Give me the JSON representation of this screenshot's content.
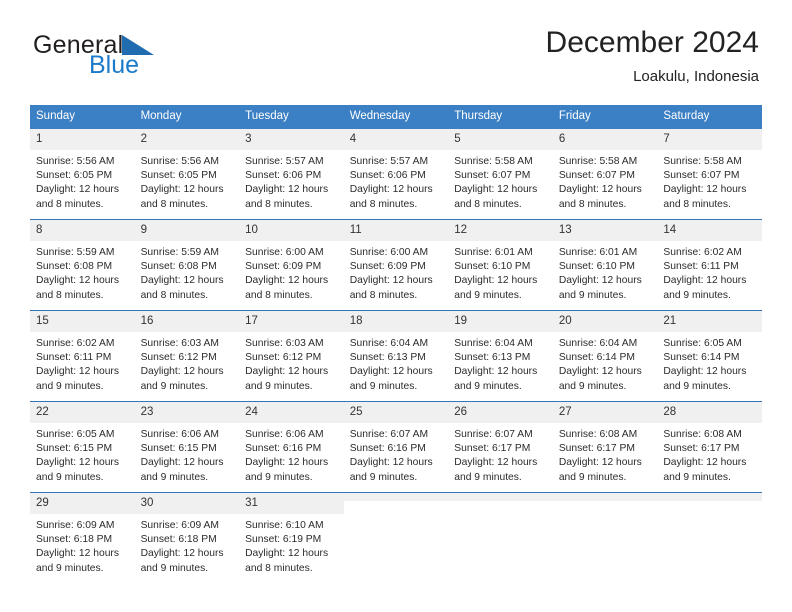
{
  "brand": {
    "name_part1": "General",
    "name_part2": "Blue",
    "logo_icon": "triangle-icon"
  },
  "header": {
    "title": "December 2024",
    "location": "Loakulu, Indonesia"
  },
  "colors": {
    "header_blue": "#3b7fc4",
    "separator_blue": "#2f76bb",
    "daynum_gray": "#f0f0f0",
    "brand_blue": "#1b7ac9"
  },
  "weekday_headers": [
    "Sunday",
    "Monday",
    "Tuesday",
    "Wednesday",
    "Thursday",
    "Friday",
    "Saturday"
  ],
  "weeks": [
    [
      {
        "day": "1",
        "sunrise": "Sunrise: 5:56 AM",
        "sunset": "Sunset: 6:05 PM",
        "daylight1": "Daylight: 12 hours",
        "daylight2": "and 8 minutes."
      },
      {
        "day": "2",
        "sunrise": "Sunrise: 5:56 AM",
        "sunset": "Sunset: 6:05 PM",
        "daylight1": "Daylight: 12 hours",
        "daylight2": "and 8 minutes."
      },
      {
        "day": "3",
        "sunrise": "Sunrise: 5:57 AM",
        "sunset": "Sunset: 6:06 PM",
        "daylight1": "Daylight: 12 hours",
        "daylight2": "and 8 minutes."
      },
      {
        "day": "4",
        "sunrise": "Sunrise: 5:57 AM",
        "sunset": "Sunset: 6:06 PM",
        "daylight1": "Daylight: 12 hours",
        "daylight2": "and 8 minutes."
      },
      {
        "day": "5",
        "sunrise": "Sunrise: 5:58 AM",
        "sunset": "Sunset: 6:07 PM",
        "daylight1": "Daylight: 12 hours",
        "daylight2": "and 8 minutes."
      },
      {
        "day": "6",
        "sunrise": "Sunrise: 5:58 AM",
        "sunset": "Sunset: 6:07 PM",
        "daylight1": "Daylight: 12 hours",
        "daylight2": "and 8 minutes."
      },
      {
        "day": "7",
        "sunrise": "Sunrise: 5:58 AM",
        "sunset": "Sunset: 6:07 PM",
        "daylight1": "Daylight: 12 hours",
        "daylight2": "and 8 minutes."
      }
    ],
    [
      {
        "day": "8",
        "sunrise": "Sunrise: 5:59 AM",
        "sunset": "Sunset: 6:08 PM",
        "daylight1": "Daylight: 12 hours",
        "daylight2": "and 8 minutes."
      },
      {
        "day": "9",
        "sunrise": "Sunrise: 5:59 AM",
        "sunset": "Sunset: 6:08 PM",
        "daylight1": "Daylight: 12 hours",
        "daylight2": "and 8 minutes."
      },
      {
        "day": "10",
        "sunrise": "Sunrise: 6:00 AM",
        "sunset": "Sunset: 6:09 PM",
        "daylight1": "Daylight: 12 hours",
        "daylight2": "and 8 minutes."
      },
      {
        "day": "11",
        "sunrise": "Sunrise: 6:00 AM",
        "sunset": "Sunset: 6:09 PM",
        "daylight1": "Daylight: 12 hours",
        "daylight2": "and 8 minutes."
      },
      {
        "day": "12",
        "sunrise": "Sunrise: 6:01 AM",
        "sunset": "Sunset: 6:10 PM",
        "daylight1": "Daylight: 12 hours",
        "daylight2": "and 9 minutes."
      },
      {
        "day": "13",
        "sunrise": "Sunrise: 6:01 AM",
        "sunset": "Sunset: 6:10 PM",
        "daylight1": "Daylight: 12 hours",
        "daylight2": "and 9 minutes."
      },
      {
        "day": "14",
        "sunrise": "Sunrise: 6:02 AM",
        "sunset": "Sunset: 6:11 PM",
        "daylight1": "Daylight: 12 hours",
        "daylight2": "and 9 minutes."
      }
    ],
    [
      {
        "day": "15",
        "sunrise": "Sunrise: 6:02 AM",
        "sunset": "Sunset: 6:11 PM",
        "daylight1": "Daylight: 12 hours",
        "daylight2": "and 9 minutes."
      },
      {
        "day": "16",
        "sunrise": "Sunrise: 6:03 AM",
        "sunset": "Sunset: 6:12 PM",
        "daylight1": "Daylight: 12 hours",
        "daylight2": "and 9 minutes."
      },
      {
        "day": "17",
        "sunrise": "Sunrise: 6:03 AM",
        "sunset": "Sunset: 6:12 PM",
        "daylight1": "Daylight: 12 hours",
        "daylight2": "and 9 minutes."
      },
      {
        "day": "18",
        "sunrise": "Sunrise: 6:04 AM",
        "sunset": "Sunset: 6:13 PM",
        "daylight1": "Daylight: 12 hours",
        "daylight2": "and 9 minutes."
      },
      {
        "day": "19",
        "sunrise": "Sunrise: 6:04 AM",
        "sunset": "Sunset: 6:13 PM",
        "daylight1": "Daylight: 12 hours",
        "daylight2": "and 9 minutes."
      },
      {
        "day": "20",
        "sunrise": "Sunrise: 6:04 AM",
        "sunset": "Sunset: 6:14 PM",
        "daylight1": "Daylight: 12 hours",
        "daylight2": "and 9 minutes."
      },
      {
        "day": "21",
        "sunrise": "Sunrise: 6:05 AM",
        "sunset": "Sunset: 6:14 PM",
        "daylight1": "Daylight: 12 hours",
        "daylight2": "and 9 minutes."
      }
    ],
    [
      {
        "day": "22",
        "sunrise": "Sunrise: 6:05 AM",
        "sunset": "Sunset: 6:15 PM",
        "daylight1": "Daylight: 12 hours",
        "daylight2": "and 9 minutes."
      },
      {
        "day": "23",
        "sunrise": "Sunrise: 6:06 AM",
        "sunset": "Sunset: 6:15 PM",
        "daylight1": "Daylight: 12 hours",
        "daylight2": "and 9 minutes."
      },
      {
        "day": "24",
        "sunrise": "Sunrise: 6:06 AM",
        "sunset": "Sunset: 6:16 PM",
        "daylight1": "Daylight: 12 hours",
        "daylight2": "and 9 minutes."
      },
      {
        "day": "25",
        "sunrise": "Sunrise: 6:07 AM",
        "sunset": "Sunset: 6:16 PM",
        "daylight1": "Daylight: 12 hours",
        "daylight2": "and 9 minutes."
      },
      {
        "day": "26",
        "sunrise": "Sunrise: 6:07 AM",
        "sunset": "Sunset: 6:17 PM",
        "daylight1": "Daylight: 12 hours",
        "daylight2": "and 9 minutes."
      },
      {
        "day": "27",
        "sunrise": "Sunrise: 6:08 AM",
        "sunset": "Sunset: 6:17 PM",
        "daylight1": "Daylight: 12 hours",
        "daylight2": "and 9 minutes."
      },
      {
        "day": "28",
        "sunrise": "Sunrise: 6:08 AM",
        "sunset": "Sunset: 6:17 PM",
        "daylight1": "Daylight: 12 hours",
        "daylight2": "and 9 minutes."
      }
    ],
    [
      {
        "day": "29",
        "sunrise": "Sunrise: 6:09 AM",
        "sunset": "Sunset: 6:18 PM",
        "daylight1": "Daylight: 12 hours",
        "daylight2": "and 9 minutes."
      },
      {
        "day": "30",
        "sunrise": "Sunrise: 6:09 AM",
        "sunset": "Sunset: 6:18 PM",
        "daylight1": "Daylight: 12 hours",
        "daylight2": "and 9 minutes."
      },
      {
        "day": "31",
        "sunrise": "Sunrise: 6:10 AM",
        "sunset": "Sunset: 6:19 PM",
        "daylight1": "Daylight: 12 hours",
        "daylight2": "and 8 minutes."
      },
      {
        "day": "",
        "sunrise": "",
        "sunset": "",
        "daylight1": "",
        "daylight2": ""
      },
      {
        "day": "",
        "sunrise": "",
        "sunset": "",
        "daylight1": "",
        "daylight2": ""
      },
      {
        "day": "",
        "sunrise": "",
        "sunset": "",
        "daylight1": "",
        "daylight2": ""
      },
      {
        "day": "",
        "sunrise": "",
        "sunset": "",
        "daylight1": "",
        "daylight2": ""
      }
    ]
  ]
}
